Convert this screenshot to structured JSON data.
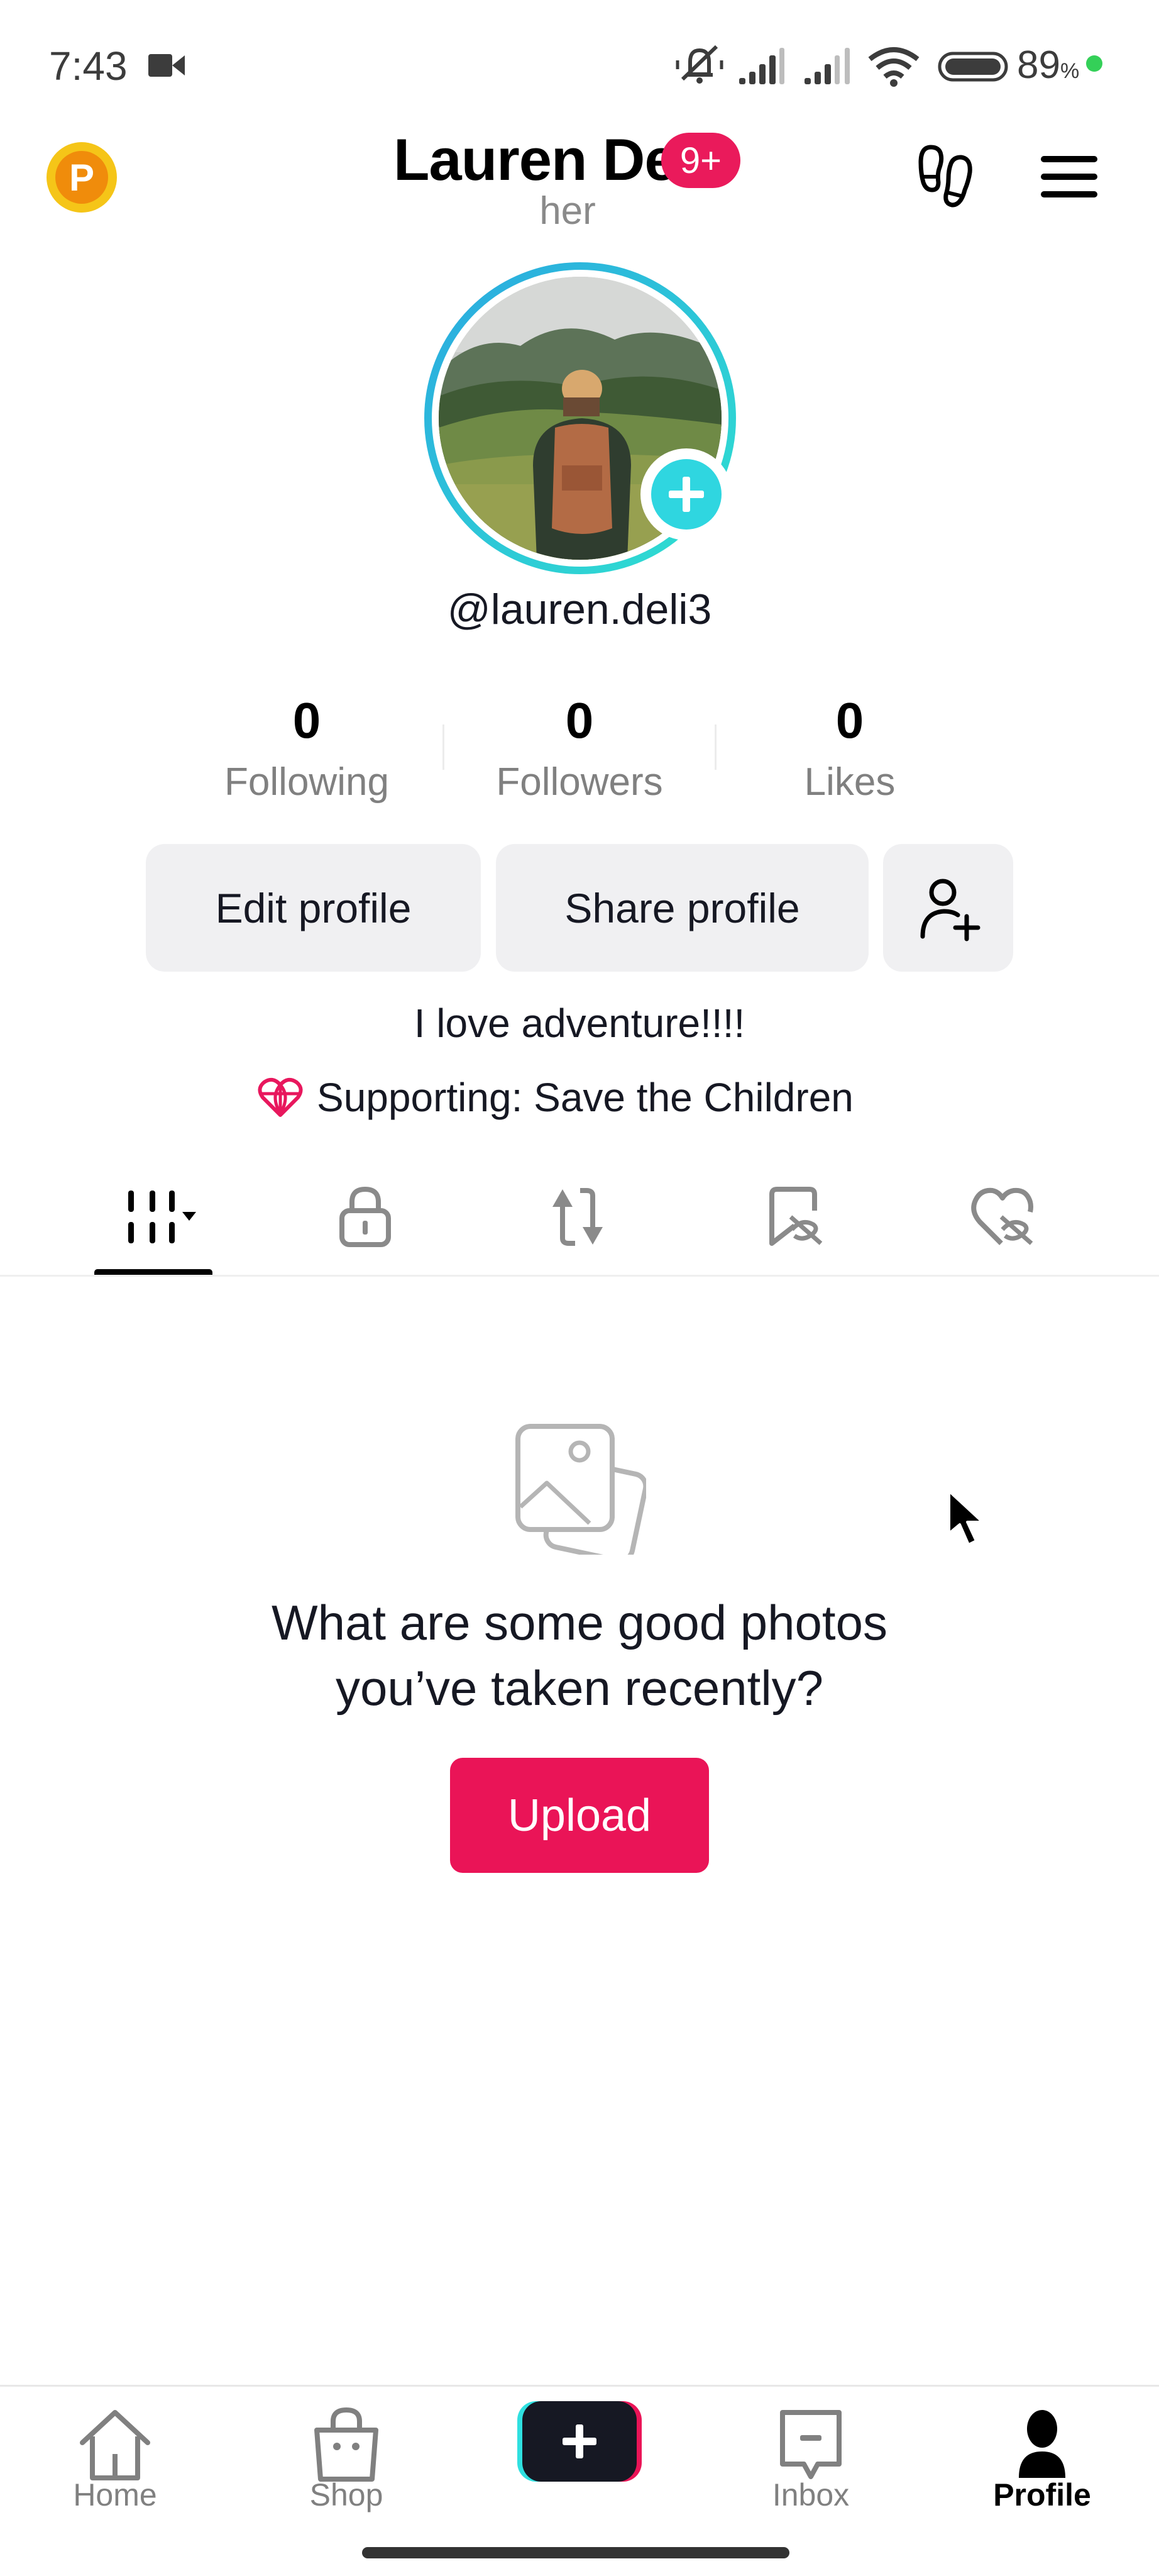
{
  "status_bar": {
    "time": "7:43",
    "recording_icon": "video-camera-icon",
    "icons": [
      "muted-bell-icon",
      "signal-icon",
      "signal-icon",
      "wifi-icon",
      "battery-icon"
    ],
    "battery_value": "89",
    "battery_unit": "%",
    "battery_dot_color": "#34d058"
  },
  "header": {
    "coin_letter": "P",
    "display_name": "Lauren Deli",
    "notification_badge": "9+",
    "pronouns": "her",
    "right_icons": [
      "footprints-icon",
      "hamburger-menu-icon"
    ]
  },
  "profile": {
    "avatar_alt": "Hiker with backpack in mountain meadow",
    "username": "@lauren.deli3",
    "stats": [
      {
        "value": "0",
        "label": "Following"
      },
      {
        "value": "0",
        "label": "Followers"
      },
      {
        "value": "0",
        "label": "Likes"
      }
    ],
    "buttons": {
      "edit": "Edit profile",
      "share": "Share profile",
      "add_friend_icon": "add-friend-icon"
    },
    "bio": "I love adventure!!!!",
    "supporting": "Supporting: Save the Children"
  },
  "tabs": [
    {
      "icon": "grid-icon",
      "active": true
    },
    {
      "icon": "lock-icon",
      "active": false
    },
    {
      "icon": "repost-icon",
      "active": false
    },
    {
      "icon": "bookmark-hidden-icon",
      "active": false
    },
    {
      "icon": "liked-hidden-icon",
      "active": false
    }
  ],
  "empty_state": {
    "line1": "What are some good photos",
    "line2": "you’ve taken recently?",
    "button": "Upload"
  },
  "bottom_nav": {
    "items": [
      {
        "label": "Home",
        "icon": "home-icon",
        "active": false
      },
      {
        "label": "Shop",
        "icon": "shop-bag-icon",
        "active": false
      },
      {
        "label": "",
        "icon": "create-plus-icon",
        "active": false
      },
      {
        "label": "Inbox",
        "icon": "inbox-icon",
        "active": false
      },
      {
        "label": "Profile",
        "icon": "profile-icon",
        "active": true
      }
    ]
  },
  "colors": {
    "accent_pink": "#ea1457",
    "accent_teal": "#2fd6e0",
    "button_gray": "#f0f0f2",
    "text_secondary": "#808080"
  }
}
